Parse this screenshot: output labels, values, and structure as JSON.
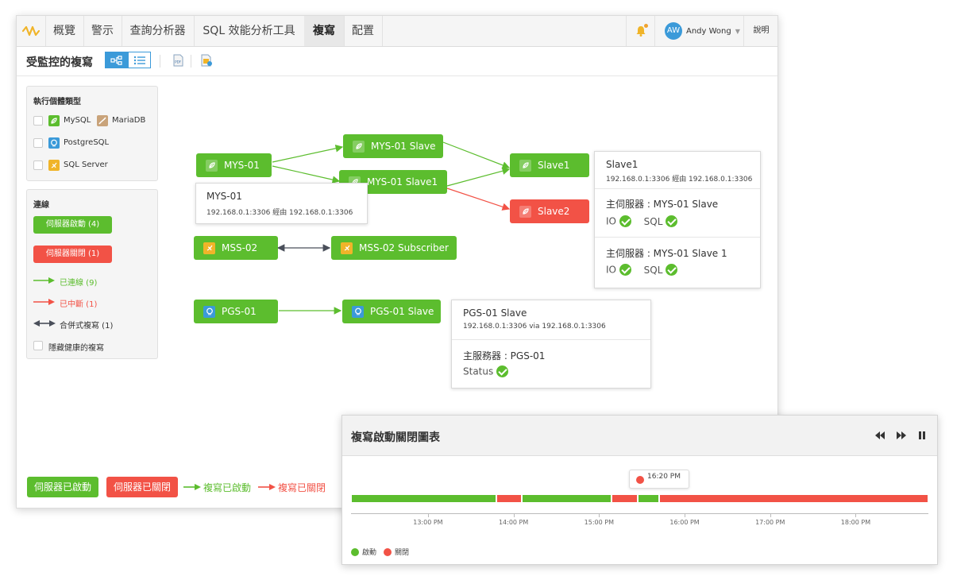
{
  "nav": {
    "tabs": [
      "概覽",
      "警示",
      "查詢分析器",
      "SQL 效能分析工具",
      "複寫",
      "配置"
    ],
    "active_tab": "複寫",
    "user_initials": "AW",
    "user_name": "Andy Wong",
    "help_label": "說明"
  },
  "page": {
    "title": "受監控的複寫"
  },
  "filters": {
    "title": "執行個體類型",
    "types": [
      "MySQL",
      "MariaDB",
      "PostgreSQL",
      "SQL Server"
    ]
  },
  "connections": {
    "title": "連線",
    "server_up": "伺服器啟動 (4)",
    "server_down": "伺服器關閉 (1)",
    "connected": "已連線 (9)",
    "disconnected": "已中斷 (1)",
    "merge": "合併式複寫 (1)",
    "hide_healthy": "隱藏健康的複寫"
  },
  "nodes": {
    "mys01": "MYS-01",
    "mys01_slave": "MYS-01 Slave",
    "mys01_slave1": "MYS-01 Slave1",
    "slave1": "Slave1",
    "slave2": "Slave2",
    "mss02": "MSS-02",
    "mss02_sub": "MSS-02 Subscriber",
    "pgs01": "PGS-01",
    "pgs01_slave": "PGS-01 Slave"
  },
  "cards": {
    "mys01": {
      "name": "MYS-01",
      "address": "192.168.0.1:3306 經由 192.168.0.1:3306"
    },
    "slave1": {
      "name": "Slave1",
      "address": "192.168.0.1:3306 經由 192.168.0.1:3306",
      "master1": "主伺服器 : MYS-01 Slave",
      "master2": "主伺服器 : MYS-01 Slave 1",
      "io": "IO",
      "sql": "SQL"
    },
    "pgs": {
      "name": "PGS-01 Slave",
      "address": "192.168.0.1:3306 via 192.168.0.1:3306",
      "master": "主服務器 : PGS-01",
      "status": "Status"
    }
  },
  "bottom_legend": {
    "server_up": "伺服器已啟動",
    "server_down": "伺服器已關閉",
    "repl_up": "複寫已啟動",
    "repl_down": "複寫已關閉"
  },
  "colors": {
    "green": "#5cbd2e",
    "red": "#f25246",
    "blue": "#3b9ad9",
    "dark": "#4a4f5a"
  },
  "chart": {
    "title": "複寫啟動關閉圖表",
    "tooltip_time": "16:20 PM",
    "ticks": [
      "13:00 PM",
      "14:00 PM",
      "15:00 PM",
      "16:00 PM",
      "17:00 PM",
      "18:00 PM"
    ],
    "legend_up": "啟動",
    "legend_down": "關閉"
  },
  "chart_data": {
    "type": "timeline",
    "x_ticks": [
      "13:00 PM",
      "14:00 PM",
      "15:00 PM",
      "16:00 PM",
      "17:00 PM",
      "18:00 PM"
    ],
    "x_range_hours": [
      12.1,
      18.85
    ],
    "segments": [
      {
        "start": 12.1,
        "end": 13.8,
        "state": "啟動"
      },
      {
        "start": 13.8,
        "end": 14.1,
        "state": "關閉"
      },
      {
        "start": 14.1,
        "end": 15.15,
        "state": "啟動"
      },
      {
        "start": 15.15,
        "end": 15.45,
        "state": "關閉"
      },
      {
        "start": 15.45,
        "end": 15.7,
        "state": "啟動"
      },
      {
        "start": 15.7,
        "end": 18.85,
        "state": "關閉"
      }
    ],
    "marker": {
      "time": "16:20 PM",
      "state": "關閉"
    },
    "legend": [
      "啟動",
      "關閉"
    ]
  }
}
